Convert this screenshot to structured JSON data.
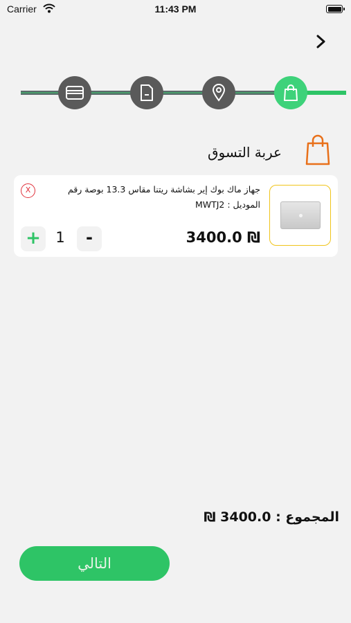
{
  "status_bar": {
    "carrier": "Carrier",
    "time": "11:43 PM"
  },
  "nav": {
    "back_icon": "chevron-right-icon"
  },
  "stepper": {
    "steps": [
      {
        "icon": "credit-card-icon",
        "active": false
      },
      {
        "icon": "document-icon",
        "active": false
      },
      {
        "icon": "location-pin-icon",
        "active": false
      },
      {
        "icon": "shopping-bag-icon",
        "active": true
      }
    ],
    "colors": {
      "inactive": "#5a5a5a",
      "active": "#3ed27a",
      "track": "#5a6a6a",
      "track_done": "#2ec466"
    }
  },
  "cart": {
    "title": "عربة التسوق",
    "title_icon": "shopping-bag-icon",
    "accent": "#e8701a"
  },
  "items": [
    {
      "name_line1": "جهاز ماك بوك إير بشاشة ريتنا مقاس 13.3 بوصة رقم",
      "name_line2": "الموديل : MWTJ2",
      "price": "3400.0 ₪",
      "quantity": "1",
      "plus_label": "+",
      "minus_label": "-",
      "remove_label": "X"
    }
  ],
  "summary": {
    "total_text": "المجموع : 3400.0 ₪"
  },
  "footer": {
    "next_label": "التالي",
    "next_color": "#2ec466"
  }
}
